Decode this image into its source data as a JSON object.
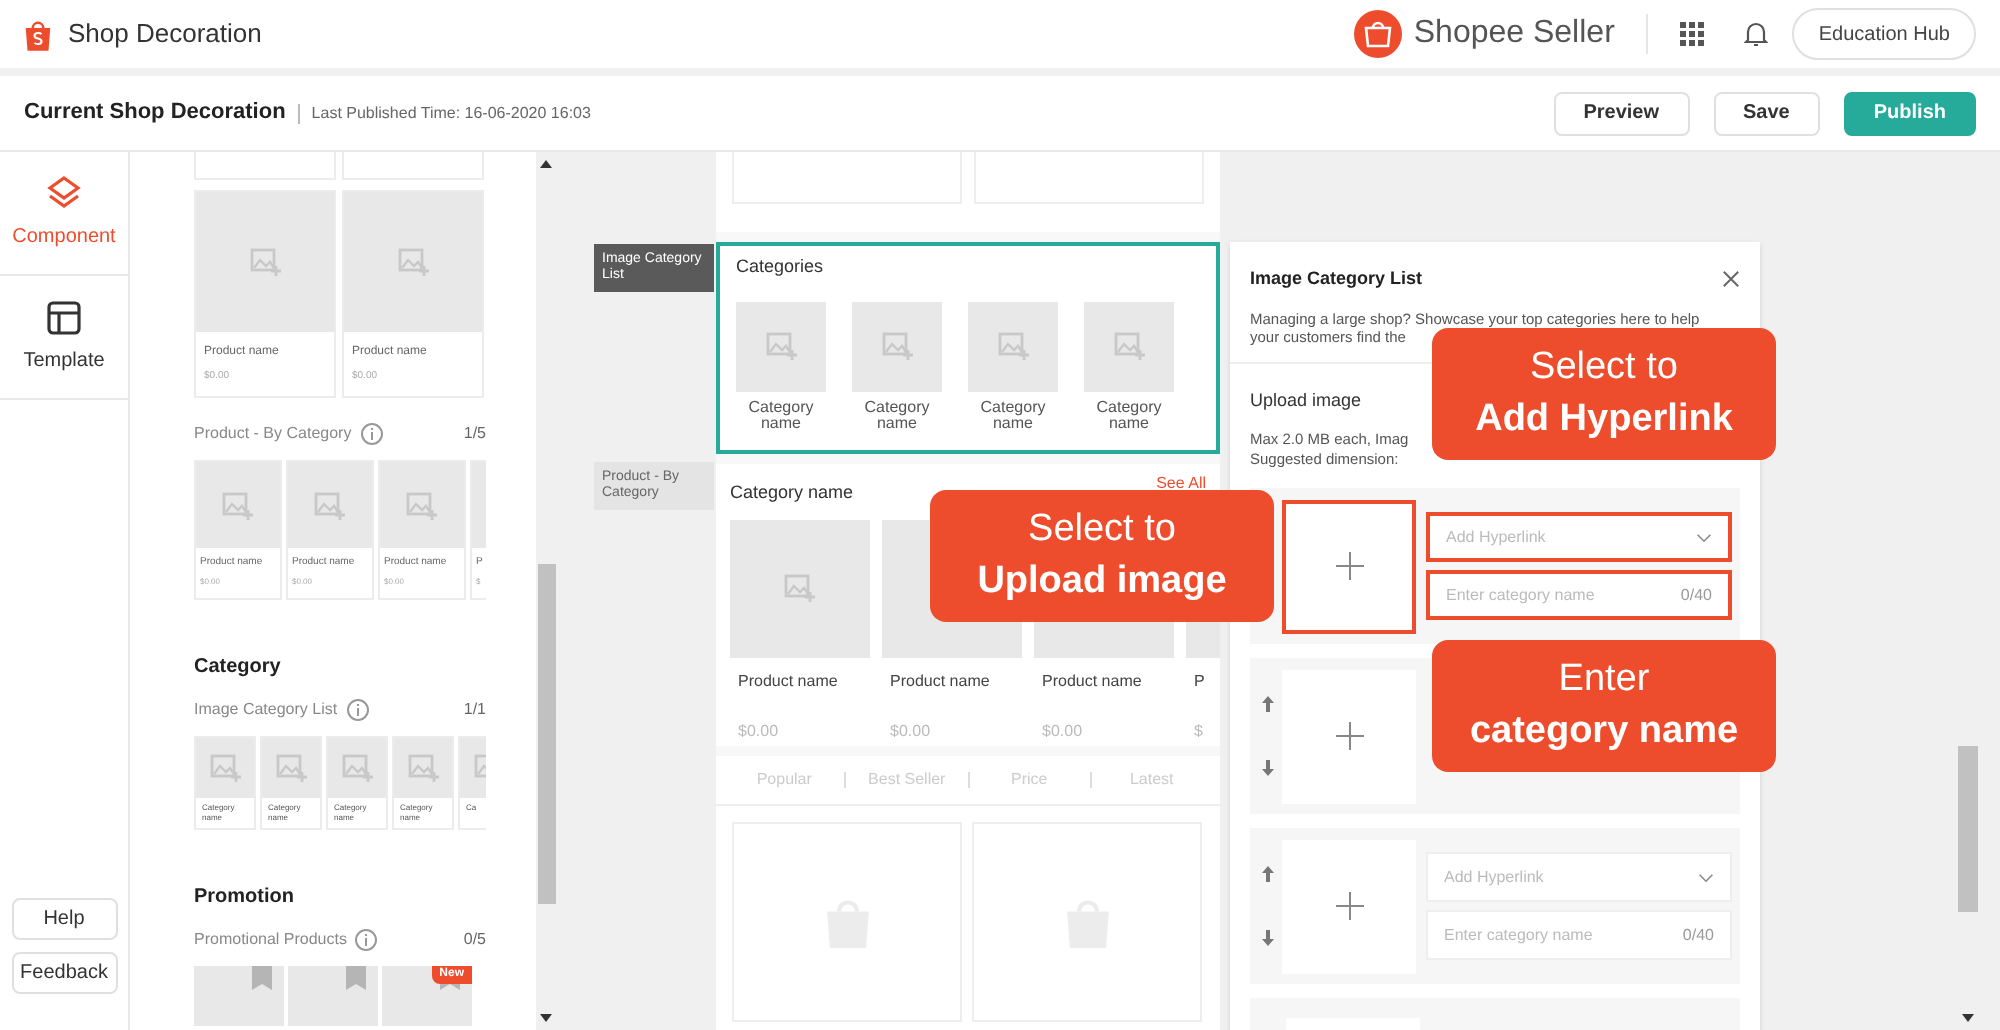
{
  "header": {
    "title": "Shop Decoration",
    "brand": "Shopee Seller",
    "education_hub": "Education Hub"
  },
  "toolbar": {
    "title": "Current Shop Decoration",
    "last_published": "Last Published Time: 16-06-2020 16:03",
    "buttons": [
      {
        "label": "Preview",
        "kind": "plain"
      },
      {
        "label": "Save",
        "kind": "plain"
      },
      {
        "label": "Publish",
        "kind": "primary"
      }
    ]
  },
  "nav": [
    {
      "label": "Component",
      "selected": true,
      "kind": "layers"
    },
    {
      "label": "Template",
      "selected": false,
      "kind": "layout"
    }
  ],
  "nav_footer": [
    "Help",
    "Feedback"
  ],
  "component_panel": {
    "top_products": [
      {
        "name": "Product name",
        "price": "$0.00"
      },
      {
        "name": "Product name",
        "price": "$0.00"
      }
    ],
    "groups": [
      {
        "title": "Product - By Category",
        "count": "1/5",
        "kind": "product",
        "items": [
          {
            "name": "Product name",
            "price": "$0.00",
            "icon": true
          },
          {
            "name": "Product name",
            "price": "$0.00",
            "icon": true
          },
          {
            "name": "Product name",
            "price": "$0.00",
            "icon": true
          },
          {
            "name": "P",
            "price": "$"
          }
        ]
      },
      {
        "heading": "Category",
        "title": "Image Category List",
        "count": "1/1",
        "kind": "category",
        "items": [
          {
            "name": "Category name"
          },
          {
            "name": "Category name"
          },
          {
            "name": "Category name"
          },
          {
            "name": "Category name"
          },
          {
            "name": "Ca"
          }
        ]
      },
      {
        "heading": "Promotion",
        "title": "Promotional Products",
        "count": "0/5",
        "kind": "promotion",
        "items": [
          {
            "ribbon": true
          },
          {
            "ribbon": true
          },
          {
            "ribbon": true,
            "badge": "New"
          }
        ]
      }
    ]
  },
  "canvas": {
    "side_labels": [
      {
        "label": "Image Category List",
        "selected": true
      },
      {
        "label": "Product - By Category",
        "selected": false
      }
    ],
    "categories": {
      "title": "Categories",
      "selected": true,
      "items": [
        "Category name",
        "Category name",
        "Category name",
        "Category name"
      ]
    },
    "category_products": {
      "title": "Category name",
      "see_all": "See All",
      "products": [
        {
          "name": "Product name",
          "price": "$0.00",
          "icon": true
        },
        {
          "name": "Product name",
          "price": "$0.00"
        },
        {
          "name": "Product name",
          "price": "$0.00"
        },
        {
          "name": "P",
          "price": "$"
        }
      ]
    },
    "sort_tabs": [
      "Popular",
      "Best Seller",
      "Price",
      "Latest"
    ]
  },
  "editor": {
    "title": "Image Category List",
    "description_lines": [
      "Managing a large shop? Showcase your top categories here to help",
      "your customers find the"
    ],
    "upload_title": "Upload image",
    "info": [
      "Max 2.0 MB each, Imag",
      "Suggested dimension:"
    ],
    "rows": [
      {
        "highlighted": true,
        "hyperlink": "Add Hyperlink",
        "name_placeholder": "Enter category name",
        "counter": "0/40"
      },
      {
        "highlighted": false
      },
      {
        "highlighted": false,
        "hyperlink": "Add Hyperlink",
        "name_placeholder": "Enter category name",
        "counter": "0/40"
      }
    ]
  },
  "callouts": [
    {
      "line1": "Select to",
      "line2": "Upload image"
    },
    {
      "line1": "Select to",
      "line2": "Add Hyperlink"
    },
    {
      "line1": "Enter",
      "line2": "category name"
    }
  ]
}
